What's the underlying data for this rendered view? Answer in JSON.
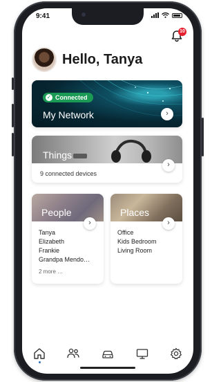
{
  "status_bar": {
    "time": "9:41"
  },
  "notifications": {
    "count": "10"
  },
  "greeting": {
    "text": "Hello, Tanya"
  },
  "network_card": {
    "badge": "Connected",
    "title": "My Network"
  },
  "things_card": {
    "title": "Things",
    "subtitle": "9 connected devices"
  },
  "people_card": {
    "title": "People",
    "names": [
      "Tanya",
      "Elizabeth",
      "Frankie",
      "Grandpa Mendo…"
    ],
    "more": "2 more …"
  },
  "places_card": {
    "title": "Places",
    "names": [
      "Office",
      "Kids Bedroom",
      "Living Room"
    ]
  },
  "tabbar": {
    "items": [
      "home-icon",
      "people-icon",
      "car-icon",
      "monitor-icon",
      "settings-icon"
    ],
    "active": "home-icon"
  },
  "colors": {
    "accent": "#2d70b8",
    "badge": "#e5202e",
    "connected": "#1a9a55"
  }
}
